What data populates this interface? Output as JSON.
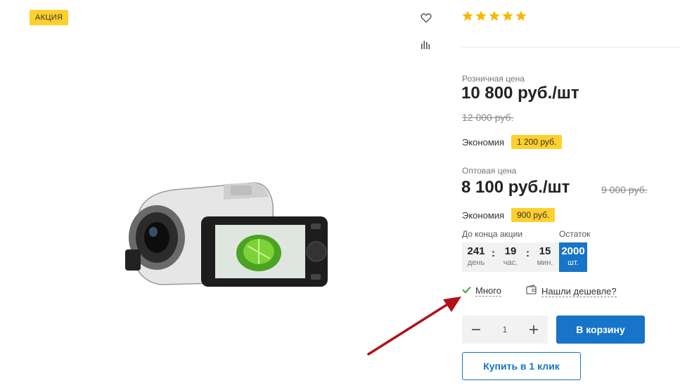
{
  "badges": {
    "sale": "АКЦИЯ"
  },
  "icons": {
    "wishlist": "heart-icon",
    "compare": "compare-chart-icon",
    "rating": "star-icon",
    "availability": "checkmark-icon",
    "cheaper": "wallet-icon",
    "minus": "minus-icon",
    "plus": "plus-icon"
  },
  "rating": {
    "value": 5,
    "max": 5
  },
  "retail": {
    "label": "Розничная цена",
    "price": "10 800 руб./шт",
    "old_price": "12 000 руб.",
    "economy_label": "Экономия",
    "economy_value": "1 200 руб."
  },
  "wholesale": {
    "label": "Оптовая цена",
    "price": "8 100 руб./шт",
    "old_price": "9 000 руб.",
    "economy_label": "Экономия",
    "economy_value": "900 руб."
  },
  "timer": {
    "label": "До конца акции",
    "days": "241",
    "days_unit": "день",
    "hours": "19",
    "hours_unit": "час.",
    "minutes": "15",
    "minutes_unit": "мин."
  },
  "stock": {
    "label": "Остаток",
    "value": "2000",
    "unit": "шт."
  },
  "availability": {
    "text": "Много"
  },
  "cheaper": {
    "text": "Нашли дешевле?"
  },
  "quantity": {
    "value": "1"
  },
  "buttons": {
    "cart": "В корзину",
    "one_click": "Купить в 1 клик"
  },
  "colors": {
    "accent_blue": "#1774c8",
    "badge_yellow": "#ffd02c",
    "star_yellow": "#f6b800",
    "check_green": "#3aa63a",
    "arrow_red": "#b0121a"
  }
}
